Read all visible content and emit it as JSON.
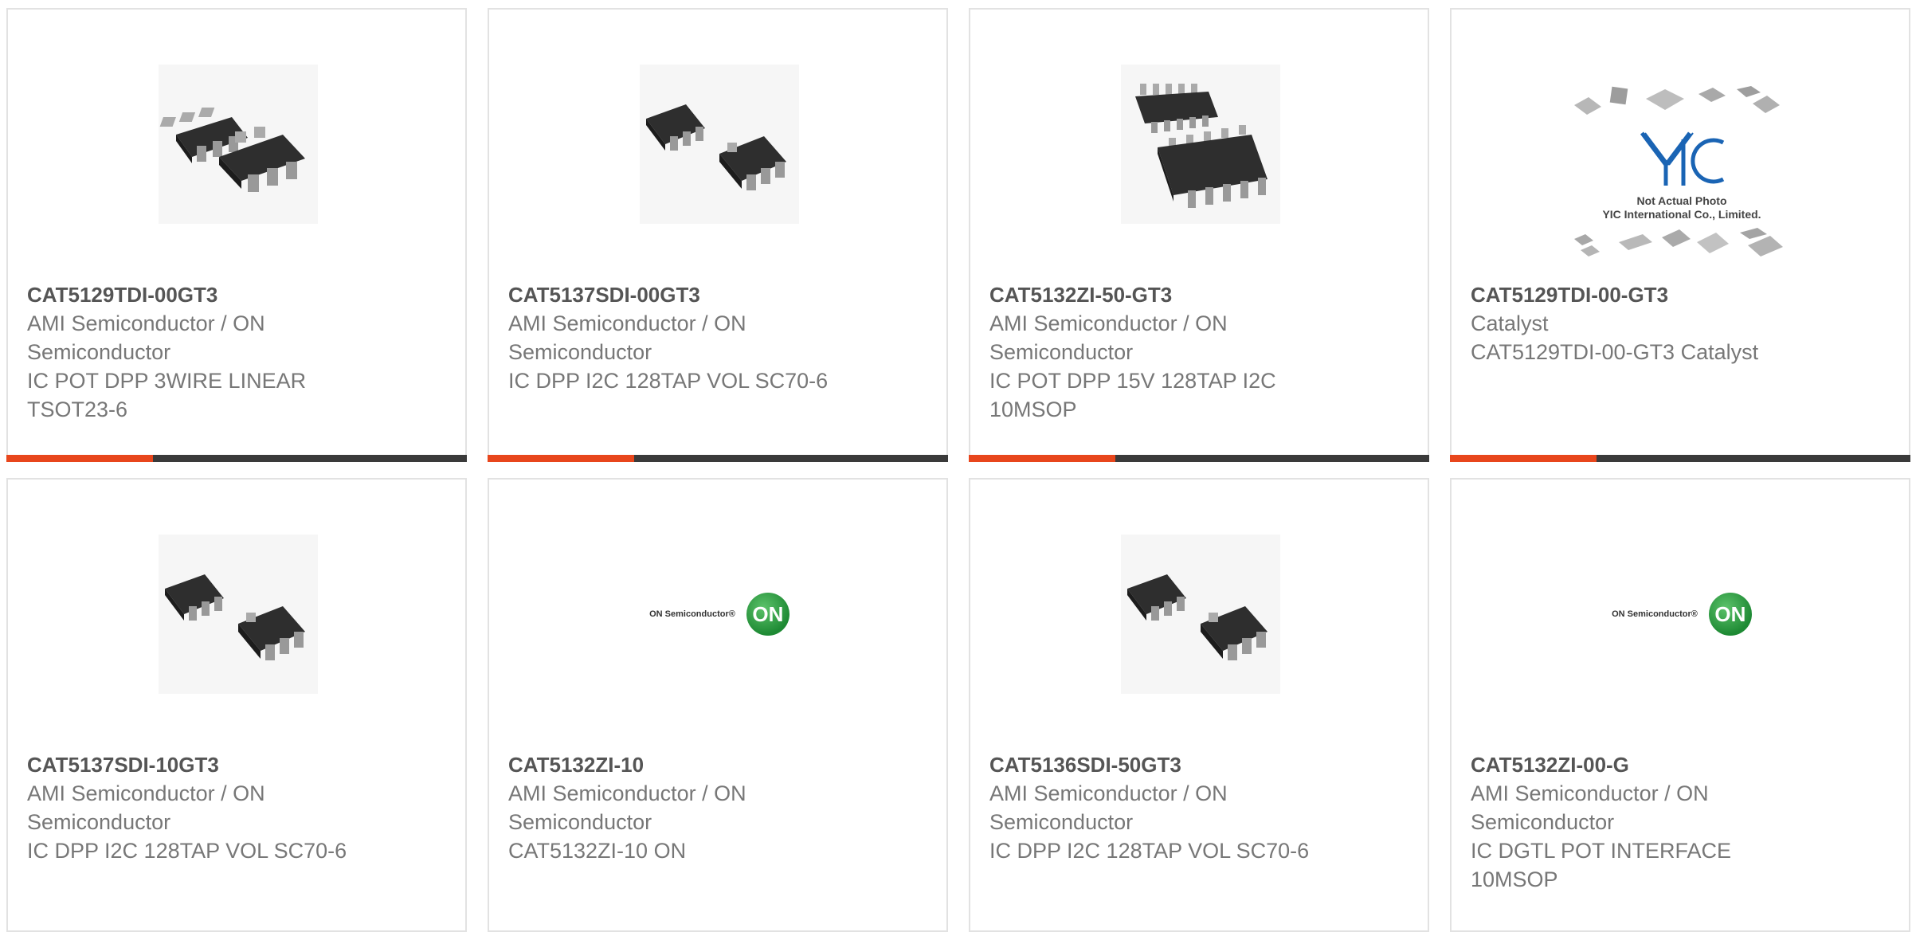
{
  "products": [
    {
      "part": "CAT5129TDI-00GT3",
      "manufacturer": "AMI Semiconductor / ON Semiconductor",
      "description": "IC POT DPP 3WIRE LINEAR TSOT23-6",
      "image": "sot23-6-chip-icon"
    },
    {
      "part": "CAT5137SDI-00GT3",
      "manufacturer": "AMI Semiconductor / ON Semiconductor",
      "description": "IC DPP I2C 128TAP VOL SC70-6",
      "image": "sc70-6-chip-icon"
    },
    {
      "part": "CAT5132ZI-50-GT3",
      "manufacturer": "AMI Semiconductor / ON Semiconductor",
      "description": "IC POT DPP 15V 128TAP I2C 10MSOP",
      "image": "msop-10-chip-icon"
    },
    {
      "part": "CAT5129TDI-00-GT3",
      "manufacturer": "Catalyst",
      "description": "CAT5129TDI-00-GT3 Catalyst",
      "image": "not-actual-photo-placeholder",
      "placeholder_brand": "YIC",
      "placeholder_caption_1": "Not Actual Photo",
      "placeholder_caption_2": "YIC International Co., Limited."
    },
    {
      "part": "CAT5137SDI-10GT3",
      "manufacturer": "AMI Semiconductor / ON Semiconductor",
      "description": "IC DPP I2C 128TAP VOL SC70-6",
      "image": "sc70-6-chip-icon"
    },
    {
      "part": "CAT5132ZI-10",
      "manufacturer": "AMI Semiconductor / ON Semiconductor",
      "description": "CAT5132ZI-10 ON",
      "image": "on-semiconductor-logo",
      "logo_text": "ON Semiconductor®",
      "logo_badge": "ON"
    },
    {
      "part": "CAT5136SDI-50GT3",
      "manufacturer": "AMI Semiconductor / ON Semiconductor",
      "description": "IC DPP I2C 128TAP VOL SC70-6",
      "image": "sc70-6-chip-icon"
    },
    {
      "part": "CAT5132ZI-00-G",
      "manufacturer": "AMI Semiconductor / ON Semiconductor",
      "description": "IC DGTL POT INTERFACE 10MSOP",
      "image": "on-semiconductor-logo",
      "logo_text": "ON Semiconductor®",
      "logo_badge": "ON"
    }
  ],
  "colors": {
    "accent": "#e8461c",
    "bar": "#3a3a3a",
    "border": "#e2e2e2",
    "title_text": "#555555",
    "body_text": "#777777"
  }
}
